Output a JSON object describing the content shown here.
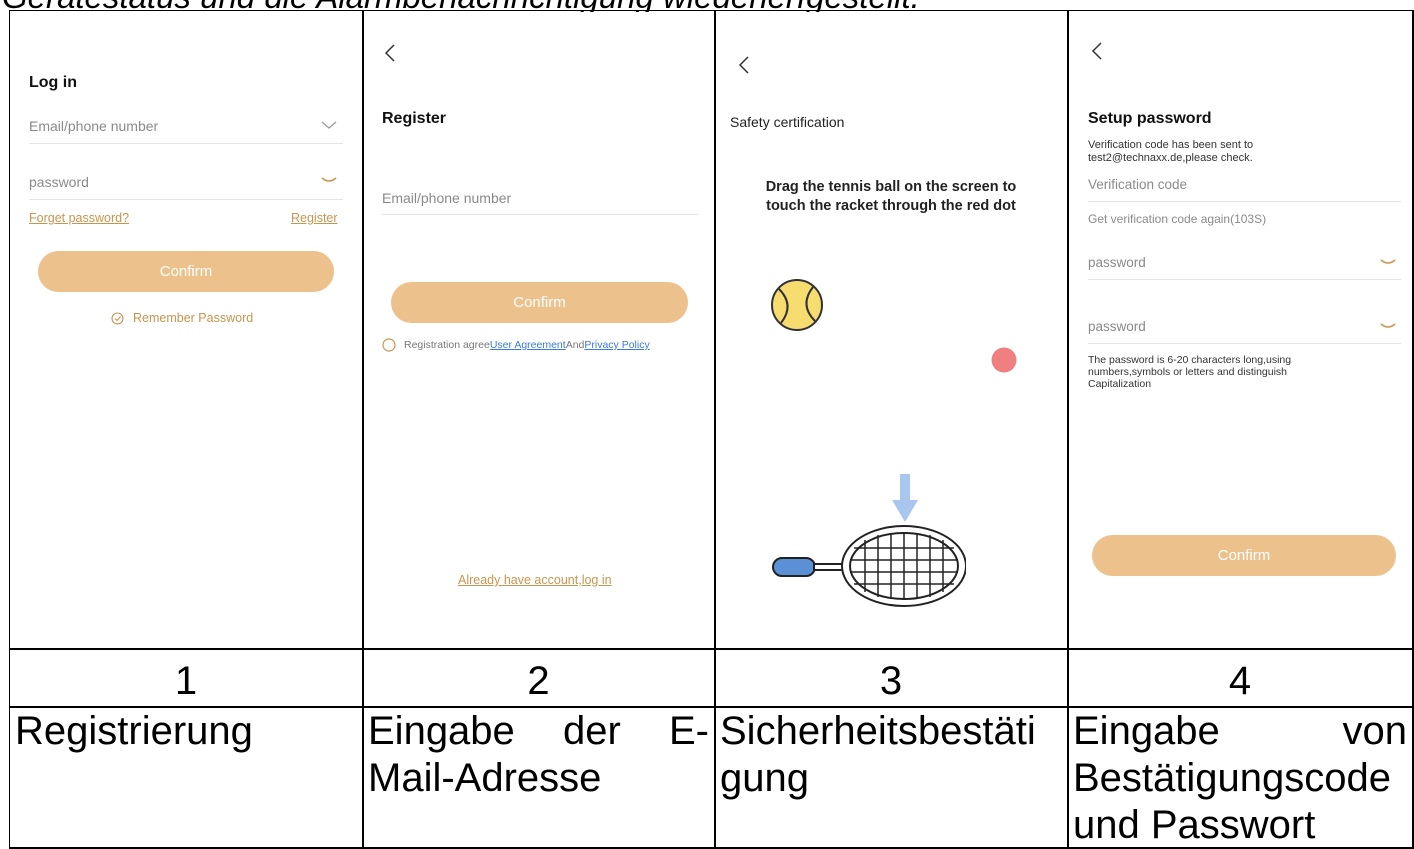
{
  "heading_fragment": "Gerätestatus und die Alarmbenachrichtigung wiedeherfgestellt.",
  "screens": {
    "login": {
      "title": "Log in",
      "email_placeholder": "Email/phone number",
      "password_placeholder": "password",
      "forget_password": "Forget password?",
      "register": "Register",
      "confirm": "Confirm",
      "remember": "Remember Password"
    },
    "register": {
      "title": "Register",
      "email_placeholder": "Email/phone number",
      "confirm": "Confirm",
      "agree_prefix": "Registration agree",
      "user_agreement": "User Agreement",
      "and": "And",
      "privacy_policy": "Privacy Policy",
      "login_link": "Already have account,log in"
    },
    "safety": {
      "title": "Safety certification",
      "instruction_line1": "Drag the tennis ball on the screen to",
      "instruction_line2": "touch the racket through the red dot"
    },
    "setup": {
      "title": "Setup password",
      "sent_line1": "Verification code has been sent to",
      "sent_line2": "test2@technaxx.de,please check.",
      "code_placeholder": "Verification code",
      "resend": "Get verification code again(103S)",
      "password1": "password",
      "password2": "password",
      "hint_line1": "The password is 6-20 characters long,using",
      "hint_line2": "numbers,symbols or letters and distinguish",
      "hint_line3": "Capitalization",
      "confirm": "Confirm"
    }
  },
  "numbers": [
    "1",
    "2",
    "3",
    "4"
  ],
  "captions": {
    "c1": "Registrierung",
    "c2_line1": "Eingabe der E-",
    "c2_line2": "Mail-Adresse",
    "c3_line1": "Sicherheitsbestäti",
    "c3_line2": "gung",
    "c4_line1": "Eingabe von",
    "c4_line2": "Bestätigungscode",
    "c4_line3": "und Passwort"
  },
  "colors": {
    "button": "#ecc18c",
    "link_gold": "#c8954f",
    "link_blue": "#3a7bd5",
    "ball_yellow": "#f7dc6f",
    "red_dot": "#f08080",
    "racket_blue": "#5b8fd6"
  }
}
